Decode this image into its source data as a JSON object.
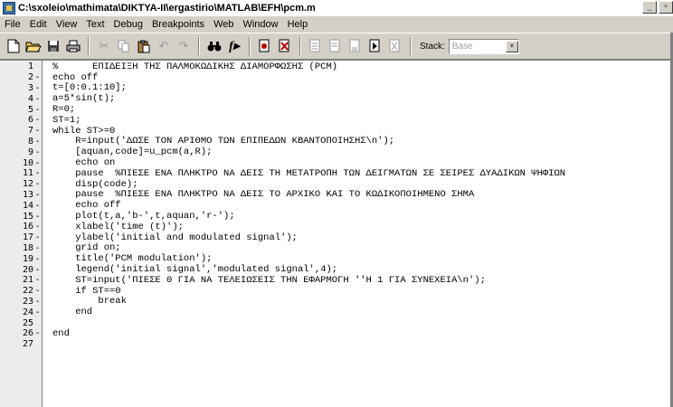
{
  "window": {
    "title": "C:\\sxoleio\\mathimata\\DIKTYA-II\\ergastirio\\MATLAB\\EFH\\pcm.m",
    "buttons": [
      "_",
      "\u0000"
    ]
  },
  "menu": [
    "File",
    "Edit",
    "View",
    "Text",
    "Debug",
    "Breakpoints",
    "Web",
    "Window",
    "Help"
  ],
  "toolbar": {
    "stack_label": "Stack:",
    "stack_value": "Base"
  },
  "editor": {
    "lines": [
      {
        "n": "1",
        "m": "",
        "code": "%      ΕΠΙΔΕΙΞΗ ΤΗΣ ΠΑΛΜΟΚΩΔΙΚΗΣ ΔΙΑΜΟΡΦΩΣΗΣ (PCM)"
      },
      {
        "n": "2",
        "m": "-",
        "code": "echo off"
      },
      {
        "n": "3",
        "m": "-",
        "code": "t=[0:0.1:10];"
      },
      {
        "n": "4",
        "m": "-",
        "code": "a=5*sin(t);"
      },
      {
        "n": "5",
        "m": "-",
        "code": "R=0;"
      },
      {
        "n": "6",
        "m": "-",
        "code": "ST=1;"
      },
      {
        "n": "7",
        "m": "-",
        "code": "while ST>=0"
      },
      {
        "n": "8",
        "m": "-",
        "code": "    R=input('ΔΩΣΕ ΤΟΝ ΑΡΙΘΜΟ ΤΩΝ ΕΠΙΠΕΔΩΝ ΚΒΑΝΤΟΠΟΙΗΣΗΣ\\n');"
      },
      {
        "n": "9",
        "m": "-",
        "code": "    [aquan,code]=u_pcm(a,R);"
      },
      {
        "n": "10",
        "m": "-",
        "code": "    echo on"
      },
      {
        "n": "11",
        "m": "-",
        "code": "    pause  %ΠΙΕΣΕ ΕΝΑ ΠΛΗΚΤΡΟ ΝΑ ΔΕΙΣ ΤΗ ΜΕΤΑΤΡΟΠΗ ΤΩΝ ΔΕΙΓΜΑΤΩΝ ΣΕ ΣΕΙΡΕΣ ΔΥΑΔΙΚΩΝ ΨΗΦΙΩΝ"
      },
      {
        "n": "12",
        "m": "-",
        "code": "    disp(code);"
      },
      {
        "n": "13",
        "m": "-",
        "code": "    pause  %ΠΙΕΣΕ ΕΝΑ ΠΛΗΚΤΡΟ ΝΑ ΔΕΙΣ ΤΟ ΑΡΧΙΚΟ ΚΑΙ ΤΟ ΚΩΔΙΚΟΠΟΙΗΜΕΝΟ ΣΗΜΑ"
      },
      {
        "n": "14",
        "m": "-",
        "code": "    echo off"
      },
      {
        "n": "15",
        "m": "-",
        "code": "    plot(t,a,'b-',t,aquan,'r-');"
      },
      {
        "n": "16",
        "m": "-",
        "code": "    xlabel('time (t)');"
      },
      {
        "n": "17",
        "m": "-",
        "code": "    ylabel('initial and modulated signal');"
      },
      {
        "n": "18",
        "m": "-",
        "code": "    grid on;"
      },
      {
        "n": "19",
        "m": "-",
        "code": "    title('PCM modulation');"
      },
      {
        "n": "20",
        "m": "-",
        "code": "    legend('initial signal','modulated signal',4);"
      },
      {
        "n": "21",
        "m": "-",
        "code": "    ST=input('ΠΙΕΣΕ 0 ΓΙΑ ΝΑ ΤΕΛΕΙΩΣΕΙΣ ΤΗΝ ΕΦΑΡΜΟΓΗ ''Η 1 ΓΙΑ ΣΥΝΕΧΕΙΑ\\n');"
      },
      {
        "n": "22",
        "m": "-",
        "code": "    if ST==0"
      },
      {
        "n": "23",
        "m": "-",
        "code": "        break"
      },
      {
        "n": "24",
        "m": "-",
        "code": "    end"
      },
      {
        "n": "25",
        "m": "",
        "code": ""
      },
      {
        "n": "26",
        "m": "-",
        "code": "end"
      },
      {
        "n": "27",
        "m": "",
        "code": ""
      }
    ]
  }
}
